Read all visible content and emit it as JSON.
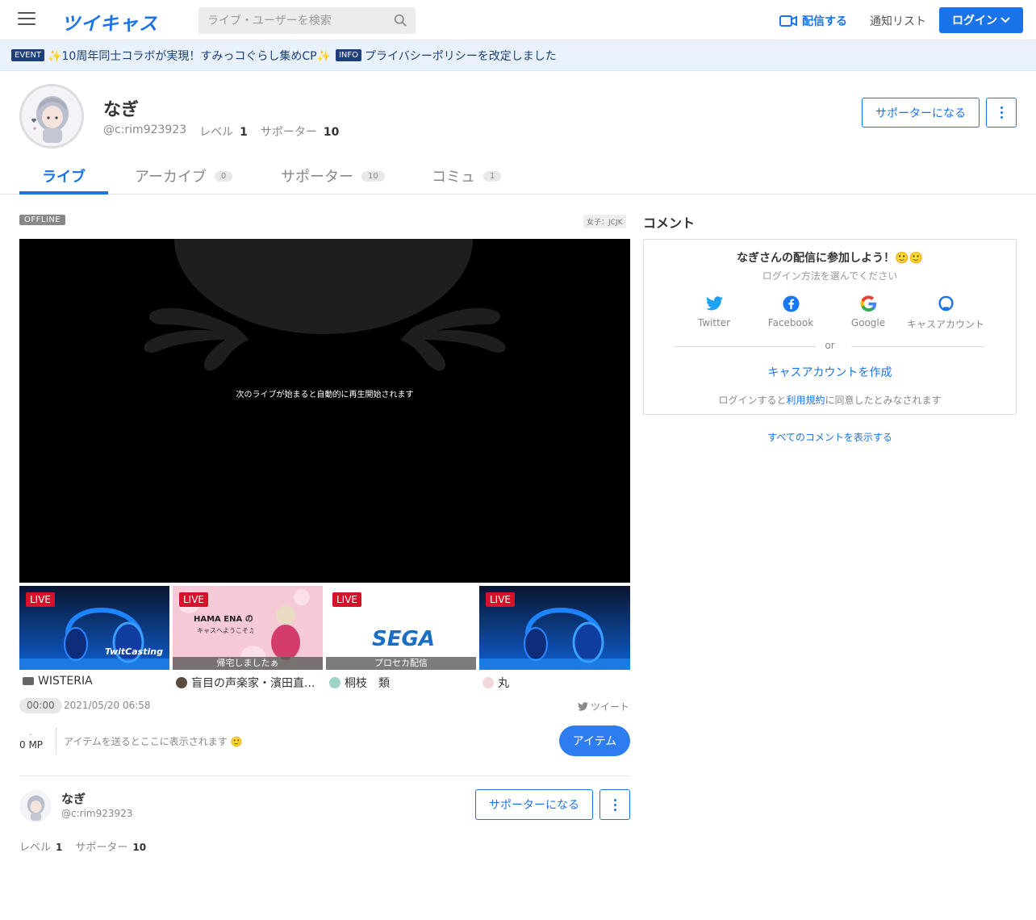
{
  "header": {
    "logo": "ツイキャス",
    "search_placeholder": "ライブ・ユーザーを検索",
    "broadcast_label": "配信する",
    "notify_label": "通知リスト",
    "login_label": "ログイン"
  },
  "infobar": {
    "event_tag": "EVENT",
    "event_text": "✨10周年同士コラボが実現！すみっコぐらし集めCP✨",
    "info_tag": "INFO",
    "info_text": "プライバシーポリシーを改定しました"
  },
  "profile": {
    "name": "なぎ",
    "id": "@c:rim923923",
    "level_label": "レベル",
    "level": "1",
    "supporter_label": "サポーター",
    "supporters": "10",
    "become_supporter": "サポーターになる"
  },
  "tabs": [
    {
      "label": "ライブ",
      "count": ""
    },
    {
      "label": "アーカイブ",
      "count": "0"
    },
    {
      "label": "サポーター",
      "count": "10"
    },
    {
      "label": "コミュ",
      "count": "1"
    }
  ],
  "player": {
    "status": "OFFLINE",
    "category": "女子：JCJK",
    "message": "次のライブが始まると自動的に再生開始されます"
  },
  "live_list": [
    {
      "tag": "LIVE",
      "title": "WISTERIA",
      "caption": "",
      "logo": "TwitCasting"
    },
    {
      "tag": "LIVE",
      "title": "盲目の声楽家・濱田直...",
      "caption": "帰宅しましたぁ",
      "banner_top": "HAMA ENA の",
      "banner_bottom": "キャスへようこそ♫"
    },
    {
      "tag": "LIVE",
      "title": "桐枝　類",
      "caption": "プロセカ配信",
      "logo": "SEGA"
    },
    {
      "tag": "LIVE",
      "title": "丸",
      "caption": ""
    }
  ],
  "meta_row": {
    "time": "00:00",
    "date": "2021/05/20 06:58",
    "tweet": "ツイート"
  },
  "items": {
    "mp_dash": "-",
    "mp": "0 MP",
    "placeholder": "アイテムを送るとここに表示されます 🙂",
    "button": "アイテム"
  },
  "comments": {
    "title": "コメント",
    "join_title": "なぎさんの配信に参加しよう！🙂🙂",
    "login_prompt": "ログイン方法を選んでください",
    "providers": [
      "Twitter",
      "Facebook",
      "Google",
      "キャスアカウント"
    ],
    "or": "or",
    "create_account": "キャスアカウントを作成",
    "terms_before": "ログインすると",
    "terms_link": "利用規約",
    "terms_after": "に同意したとみなされます",
    "show_all": "すべてのコメントを表示する"
  },
  "colors": {
    "accent": "#1a73e8",
    "live": "#d6122a",
    "info_bg": "#e8f1fc"
  }
}
